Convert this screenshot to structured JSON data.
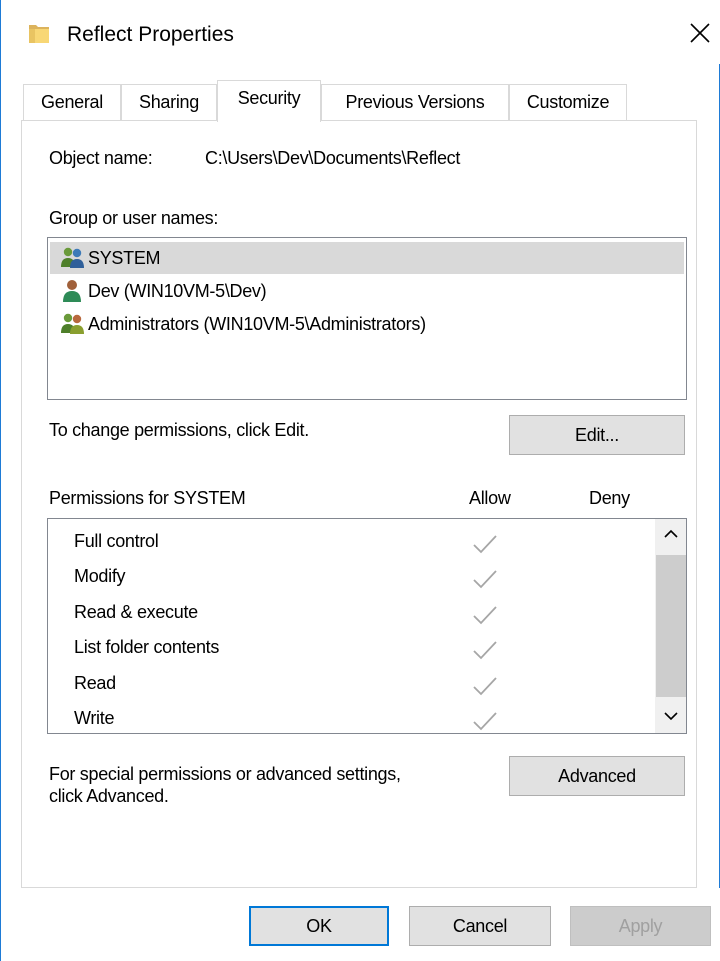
{
  "window": {
    "title": "Reflect Properties",
    "icon": "folder-icon",
    "close_glyph": "✕"
  },
  "tabs": [
    {
      "label": "General"
    },
    {
      "label": "Sharing"
    },
    {
      "label": "Security",
      "active": true
    },
    {
      "label": "Previous Versions"
    },
    {
      "label": "Customize"
    }
  ],
  "security": {
    "object_name_label": "Object name:",
    "object_name_value": "C:\\Users\\Dev\\Documents\\Reflect",
    "group_label": "Group or user names:",
    "users": [
      {
        "name": "SYSTEM",
        "icon": "group-users-icon",
        "selected": true
      },
      {
        "name": "Dev (WIN10VM-5\\Dev)",
        "icon": "user-icon"
      },
      {
        "name": "Administrators (WIN10VM-5\\Administrators)",
        "icon": "group-users-icon"
      }
    ],
    "change_hint": "To change permissions, click Edit.",
    "edit_button": "Edit...",
    "permissions_label": "Permissions for SYSTEM",
    "allow_header": "Allow",
    "deny_header": "Deny",
    "permissions": [
      {
        "name": "Full control",
        "allow": true,
        "deny": false
      },
      {
        "name": "Modify",
        "allow": true,
        "deny": false
      },
      {
        "name": "Read & execute",
        "allow": true,
        "deny": false
      },
      {
        "name": "List folder contents",
        "allow": true,
        "deny": false
      },
      {
        "name": "Read",
        "allow": true,
        "deny": false
      },
      {
        "name": "Write",
        "allow": true,
        "deny": false
      }
    ],
    "advanced_hint_line1": "For special permissions or advanced settings,",
    "advanced_hint_line2": "click Advanced.",
    "advanced_button": "Advanced"
  },
  "footer": {
    "ok": "OK",
    "cancel": "Cancel",
    "apply": "Apply"
  },
  "colors": {
    "accent": "#0078d7",
    "window_border": "#1e7bd6",
    "selection": "#d9d9d9",
    "check": "#a6a6a6"
  }
}
